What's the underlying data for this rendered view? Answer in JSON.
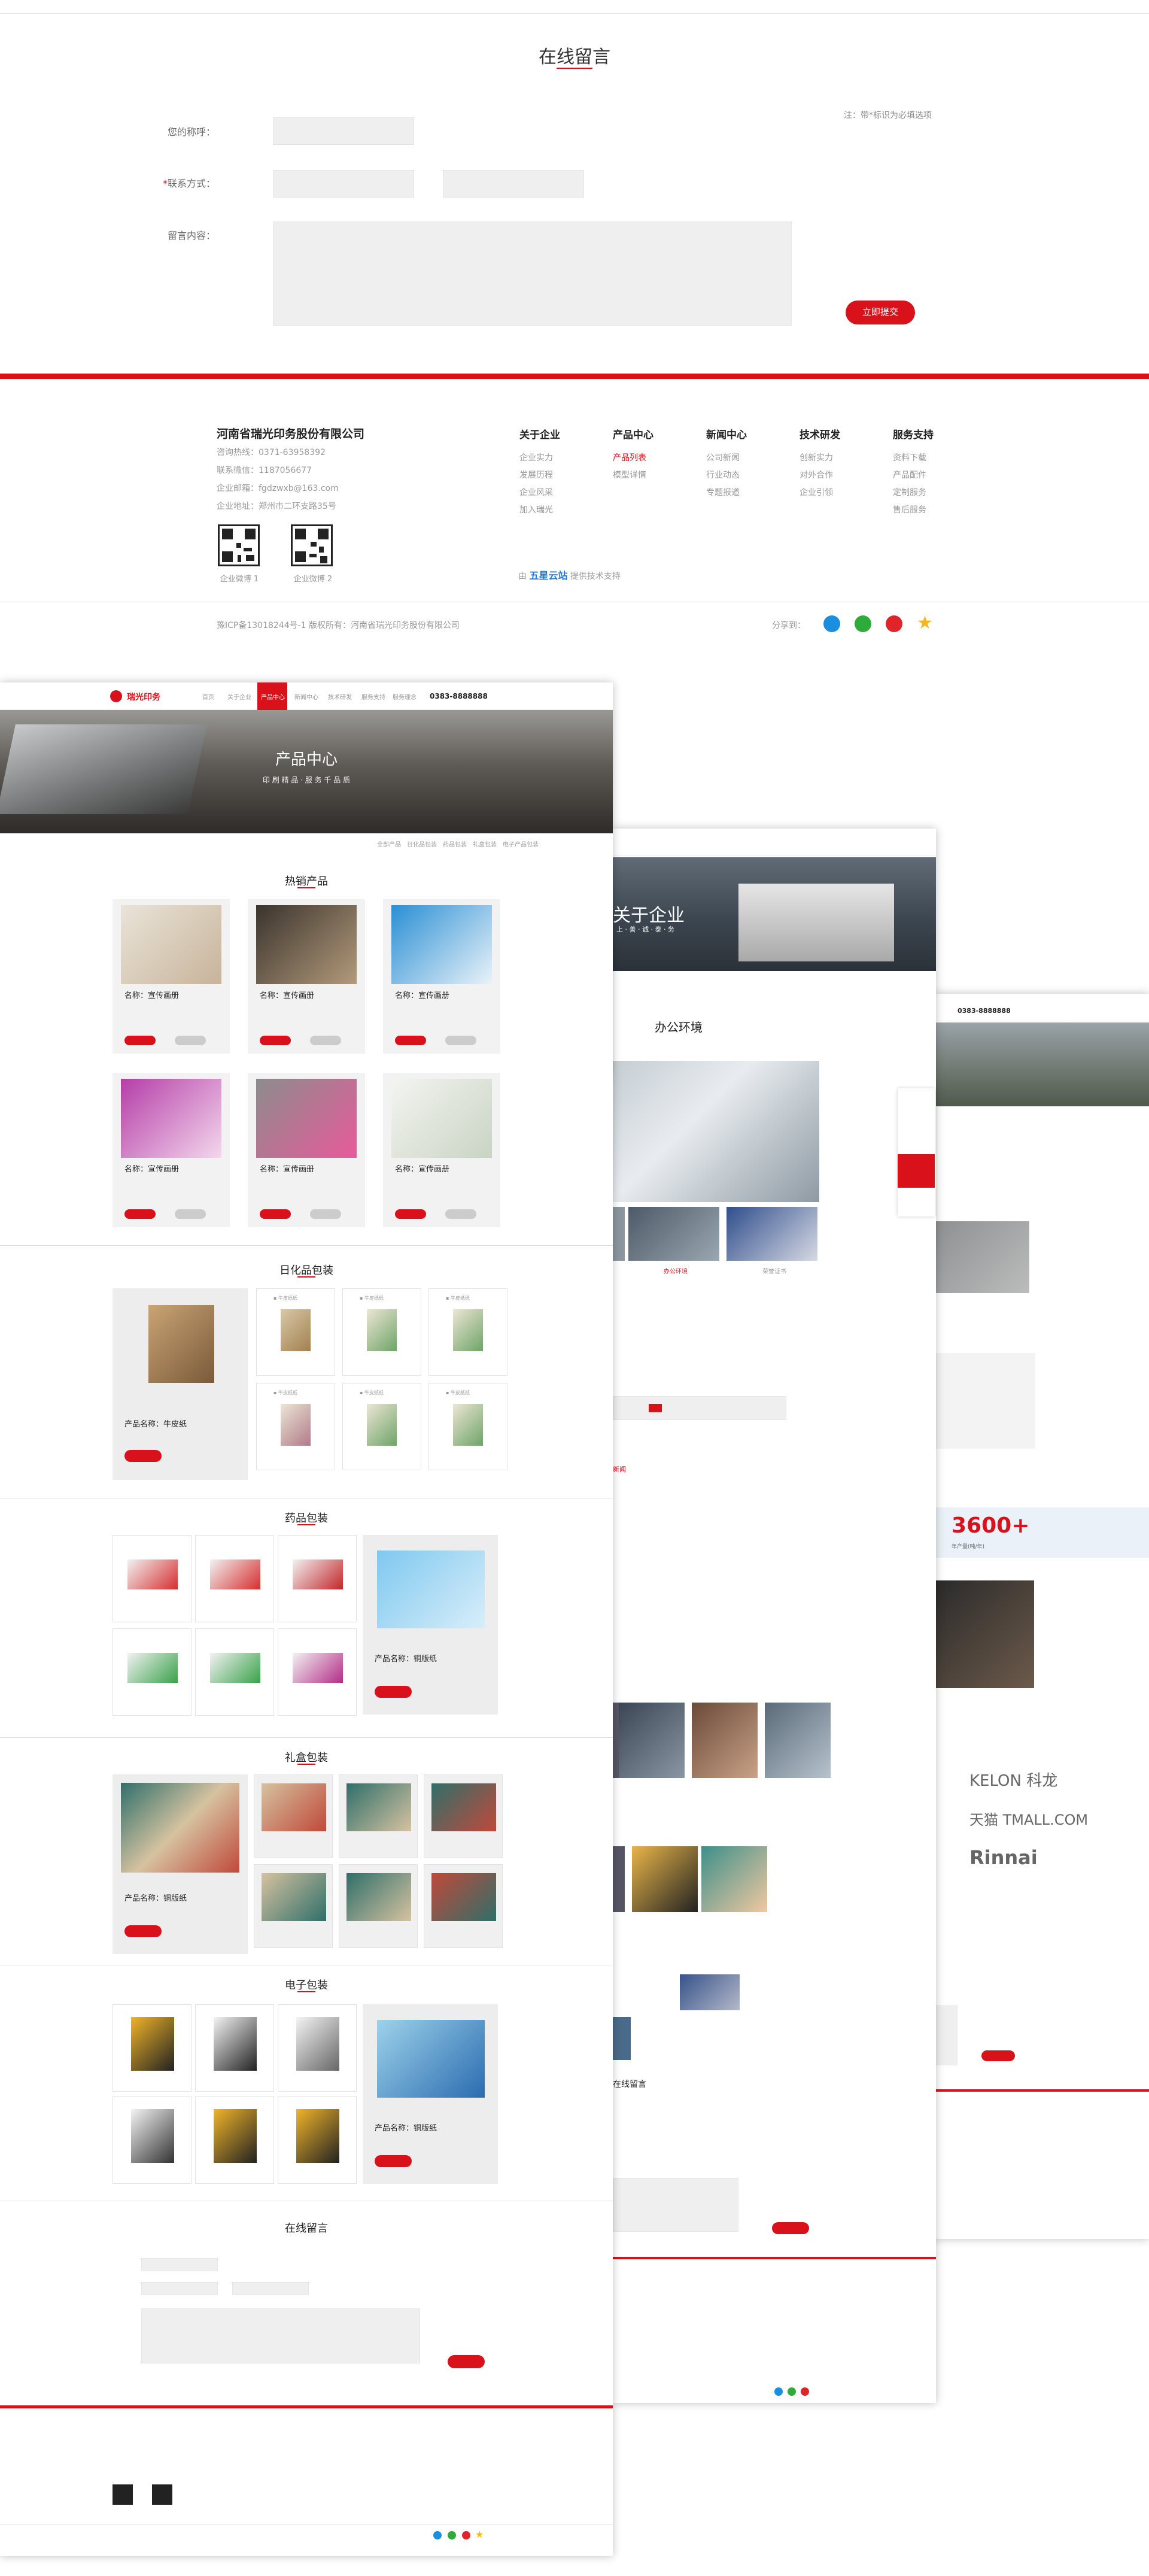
{
  "message_form": {
    "title": "在线留言",
    "note": "注：带*标识为必填选项",
    "nickname_label": "您的称呼：",
    "contact_label": "联系方式：",
    "required_mark": "*",
    "content_label": "留言内容：",
    "submit_label": "立即提交"
  },
  "footer": {
    "company": "河南省瑞光印务股份有限公司",
    "info": [
      "咨询热线：0371-63958392",
      "联系微信：1187056677",
      "企业邮箱：fgdzwxb@163.com",
      "企业地址：郑州市二环支路35号"
    ],
    "qr_captions": [
      "企业微博 1",
      "企业微博 2"
    ],
    "columns": [
      {
        "title": "关于企业",
        "items": [
          "企业实力",
          "发展历程",
          "企业风采",
          "加入瑞光"
        ],
        "active": -1
      },
      {
        "title": "产品中心",
        "items": [
          "产品列表",
          "模型详情"
        ],
        "active": 0
      },
      {
        "title": "新闻中心",
        "items": [
          "公司新闻",
          "行业动态",
          "专题报道"
        ],
        "active": -1
      },
      {
        "title": "技术研发",
        "items": [
          "创新实力",
          "对外合作",
          "企业引领"
        ],
        "active": -1
      },
      {
        "title": "服务支持",
        "items": [
          "资料下载",
          "产品配件",
          "定制服务",
          "售后服务"
        ],
        "active": -1
      }
    ],
    "powered_prefix": "由",
    "powered_logo": "五星云站",
    "powered_suffix": "提供技术支持",
    "icp": "豫ICP备13018244号-1  版权所有：河南省瑞光印务股份有限公司",
    "share_label": "分享到：",
    "share_icons": [
      {
        "name": "qq-icon",
        "color": "#1a8fe0"
      },
      {
        "name": "wechat-icon",
        "color": "#2dab3b"
      },
      {
        "name": "weibo-icon",
        "color": "#e0252a"
      },
      {
        "name": "favorite-icon",
        "color": "#f6b61c"
      }
    ]
  },
  "mockup_main": {
    "logo": "瑞光印务",
    "nav": [
      "首页",
      "关于企业",
      "产品中心",
      "新闻中心",
      "技术研发",
      "服务支持",
      "服务理念"
    ],
    "hotline": "0383-8888888",
    "banner_title": "产品中心",
    "banner_subtitle": "印 刷 精 品 · 服 务 千 品 质",
    "breadcrumb": [
      "全部产品",
      "日化品包装",
      "药品包装",
      "礼盒包装",
      "电子产品包装"
    ],
    "sections": [
      "热销产品",
      "日化品包装",
      "药品包装",
      "礼盒包装",
      "电子包装"
    ],
    "product_name": "名称：宣传画册",
    "feature_name": "产品名称：牛皮纸",
    "feature_name2": "产品名称：铜版纸",
    "tile_label": "▪ 牛皮纸纸",
    "message_title": "在线留言"
  },
  "mockup_about": {
    "banner_title": "关于企业",
    "banner_subtitle": "上 · 善 · 诚 · 泰 · 务",
    "section": "办公环境",
    "thumb_captions": [
      "办公环境",
      "荣誉证书"
    ],
    "news_title": "新闻",
    "message_title": "在线留言"
  },
  "mockup_third": {
    "hotline": "0383-8888888",
    "stat": "3600+",
    "stat_label": "年产量(吨/年)",
    "brands": [
      "KELON 科龙",
      "天猫 TMALL.COM",
      "Rinnai"
    ],
    "submit_label": "立即提交"
  }
}
